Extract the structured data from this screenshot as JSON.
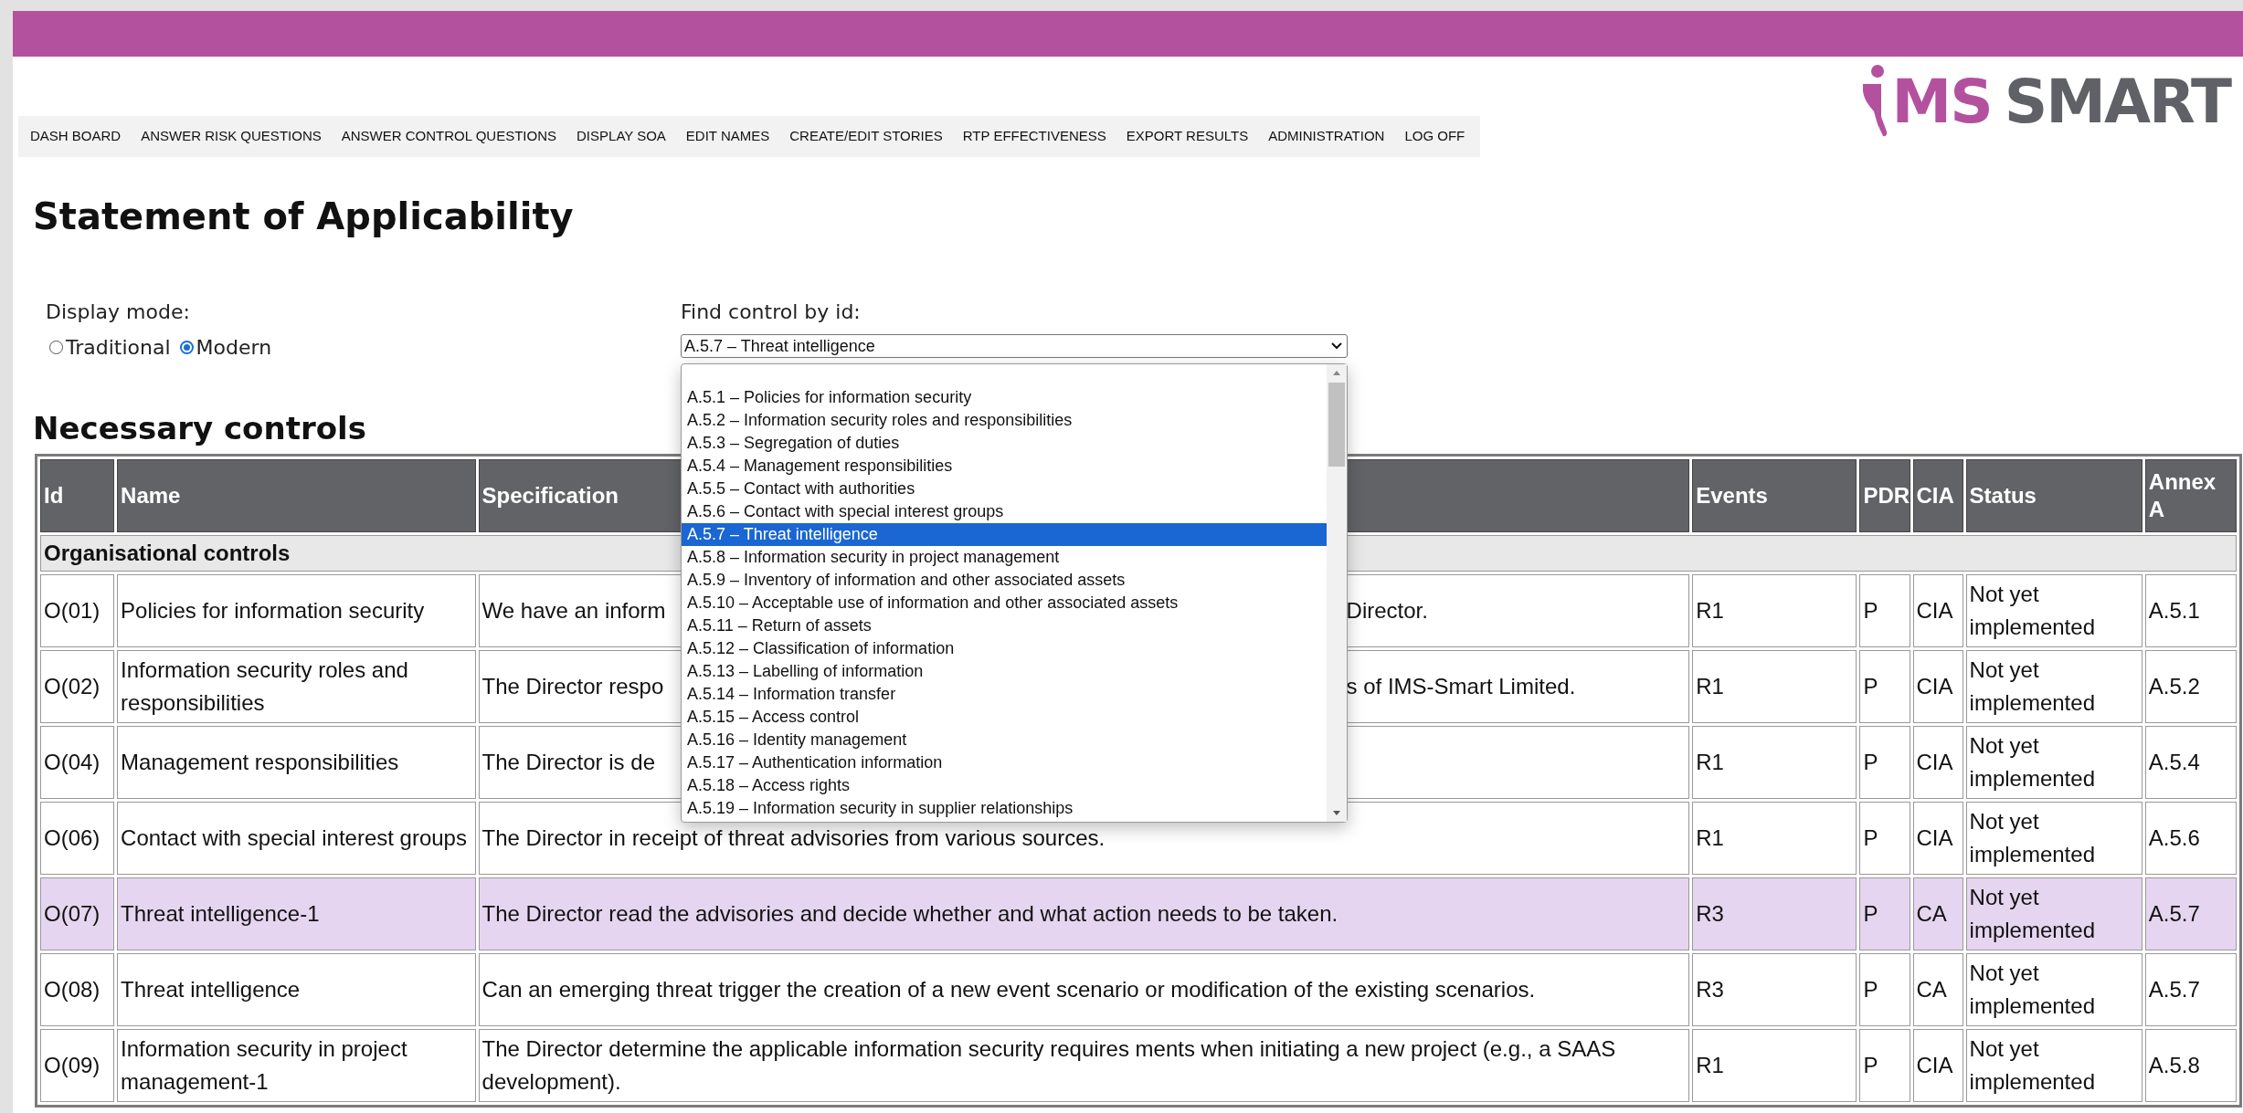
{
  "nav": [
    {
      "label": "DASH BOARD"
    },
    {
      "label": "ANSWER RISK QUESTIONS"
    },
    {
      "label": "ANSWER CONTROL QUESTIONS"
    },
    {
      "label": "DISPLAY SOA"
    },
    {
      "label": "EDIT NAMES"
    },
    {
      "label": "CREATE/EDIT STORIES"
    },
    {
      "label": "RTP EFFECTIVENESS"
    },
    {
      "label": "EXPORT RESULTS"
    },
    {
      "label": "ADMINISTRATION"
    },
    {
      "label": "LOG OFF"
    }
  ],
  "logo": {
    "accent": "MS",
    "rest": "SMART"
  },
  "title": "Statement of Applicability",
  "display_mode": {
    "label": "Display mode:",
    "options": [
      {
        "label": "Traditional",
        "selected": false
      },
      {
        "label": "Modern",
        "selected": true
      }
    ]
  },
  "find_control": {
    "label": "Find control by id:",
    "value": "A.5.7 – Threat intelligence",
    "options": [
      {
        "label": "A.5.1 – Policies for information security",
        "selected": false
      },
      {
        "label": "A.5.2 – Information security roles and responsibilities",
        "selected": false
      },
      {
        "label": "A.5.3 – Segregation of duties",
        "selected": false
      },
      {
        "label": "A.5.4 – Management responsibilities",
        "selected": false
      },
      {
        "label": "A.5.5 – Contact with authorities",
        "selected": false
      },
      {
        "label": "A.5.6 – Contact with special interest groups",
        "selected": false
      },
      {
        "label": "A.5.7 – Threat intelligence",
        "selected": true
      },
      {
        "label": "A.5.8 – Information security in project management",
        "selected": false
      },
      {
        "label": "A.5.9 – Inventory of information and other associated assets",
        "selected": false
      },
      {
        "label": "A.5.10 – Acceptable use of information and other associated assets",
        "selected": false
      },
      {
        "label": "A.5.11 – Return of assets",
        "selected": false
      },
      {
        "label": "A.5.12 – Classification of information",
        "selected": false
      },
      {
        "label": "A.5.13 – Labelling of information",
        "selected": false
      },
      {
        "label": "A.5.14 – Information transfer",
        "selected": false
      },
      {
        "label": "A.5.15 – Access control",
        "selected": false
      },
      {
        "label": "A.5.16 – Identity management",
        "selected": false
      },
      {
        "label": "A.5.17 – Authentication information",
        "selected": false
      },
      {
        "label": "A.5.18 – Access rights",
        "selected": false
      },
      {
        "label": "A.5.19 – Information security in supplier relationships",
        "selected": false
      }
    ]
  },
  "section_title": "Necessary controls",
  "table": {
    "columns": [
      "Id",
      "Name",
      "Specification",
      "Events",
      "PDR",
      "CIA",
      "Status",
      "Annex A"
    ],
    "groups": [
      {
        "title": "Organisational controls",
        "rows": [
          {
            "id": "O(01)",
            "name": "Policies for information security",
            "specification": [
              "We have an inform",
              "Director."
            ],
            "events": "R1",
            "pdr": "P",
            "cia": "CIA",
            "status": "Not yet implemented",
            "annex": "A.5.1",
            "highlighted": false
          },
          {
            "id": "O(02)",
            "name": "Information security roles and responsibilities",
            "specification": [
              "The Director respo",
              "s of IMS-Smart Limited."
            ],
            "events": "R1",
            "pdr": "P",
            "cia": "CIA",
            "status": "Not yet implemented",
            "annex": "A.5.2",
            "highlighted": false
          },
          {
            "id": "O(04)",
            "name": "Management responsibilities",
            "specification": [
              "The Director is de"
            ],
            "events": "R1",
            "pdr": "P",
            "cia": "CIA",
            "status": "Not yet implemented",
            "annex": "A.5.4",
            "highlighted": false
          },
          {
            "id": "O(06)",
            "name": "Contact with special interest groups",
            "specification": [
              "The Director in receipt of threat advisories from various sources."
            ],
            "events": "R1",
            "pdr": "P",
            "cia": "CIA",
            "status": "Not yet implemented",
            "annex": "A.5.6",
            "highlighted": false
          },
          {
            "id": "O(07)",
            "name": "Threat intelligence-1",
            "specification": [
              "The Director read the advisories and decide whether and what action needs to be taken."
            ],
            "events": "R3",
            "pdr": "P",
            "cia": "CA",
            "status": "Not yet implemented",
            "annex": "A.5.7",
            "highlighted": true
          },
          {
            "id": "O(08)",
            "name": "Threat intelligence",
            "specification": [
              "Can an emerging threat trigger the creation of a new event scenario or modification of the existing scenarios."
            ],
            "events": "R3",
            "pdr": "P",
            "cia": "CA",
            "status": "Not yet implemented",
            "annex": "A.5.7",
            "highlighted": false
          },
          {
            "id": "O(09)",
            "name": "Information security in project management-1",
            "specification": [
              "The Director determine the applicable information security requires ments when initiating a new project (e.g., a SAAS development)."
            ],
            "events": "R1",
            "pdr": "P",
            "cia": "CIA",
            "status": "Not yet implemented",
            "annex": "A.5.8",
            "highlighted": false
          }
        ]
      }
    ]
  }
}
